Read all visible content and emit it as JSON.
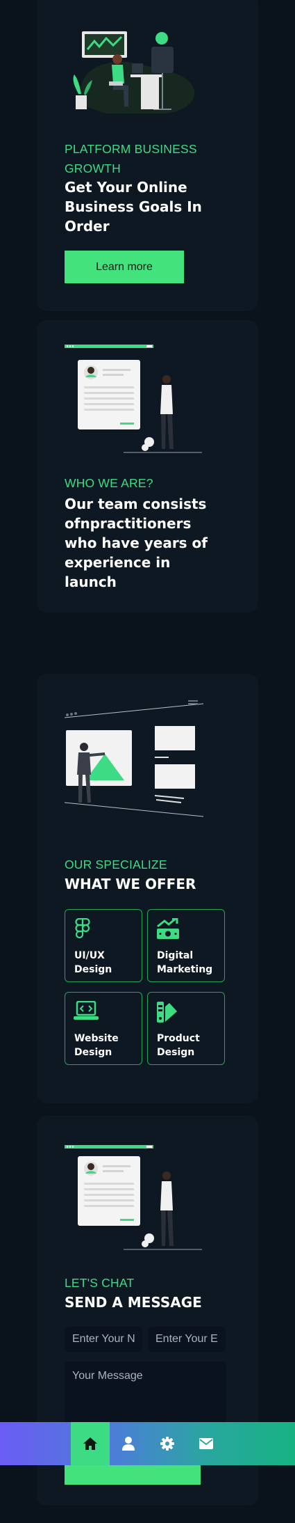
{
  "hero": {
    "kicker": "PLATFORM BUSINESS GROWTH",
    "title": "Get Your Online Business Goals In Order",
    "button_label": "Learn more"
  },
  "about": {
    "kicker": "WHO WE ARE?",
    "title": "Our team consists ofnpractitioners who have years of experience in launch"
  },
  "services": {
    "kicker": "OUR SPECIALIZE",
    "title": "WHAT WE OFFER",
    "items": [
      {
        "label": "UI/UX\nDesign",
        "icon": "figma-icon"
      },
      {
        "label": "Digital\nMarketing",
        "icon": "money-growth-icon"
      },
      {
        "label": "Website\nDesign",
        "icon": "laptop-code-icon"
      },
      {
        "label": "Product\nDesign",
        "icon": "swatchbook-icon"
      }
    ]
  },
  "contact": {
    "kicker": "LET'S CHAT",
    "title": "SEND A MESSAGE",
    "name_placeholder": "Enter Your Name",
    "email_placeholder": "Enter Your Email",
    "message_placeholder": "Your Message"
  },
  "nav": {
    "items": [
      "home-icon",
      "user-icon",
      "gear-icon",
      "envelope-icon"
    ],
    "active": "home-icon"
  },
  "colors": {
    "accent": "#3ddc84",
    "background": "#0a121c",
    "card": "#0e1822"
  }
}
